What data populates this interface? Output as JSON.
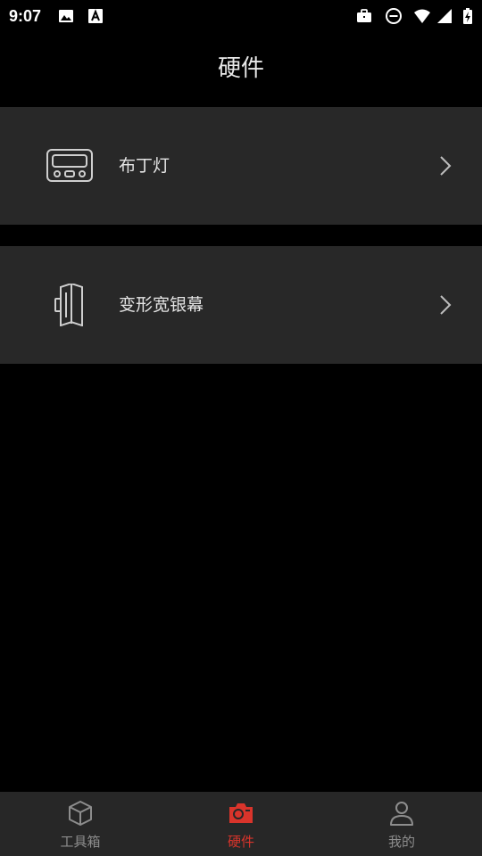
{
  "status_bar": {
    "time": "9:07",
    "icons": [
      "image-icon",
      "font-a-icon",
      "briefcase-icon",
      "do-not-disturb-icon",
      "wifi-icon",
      "cellular-signal-icon",
      "battery-charging-icon"
    ]
  },
  "header": {
    "title": "硬件"
  },
  "devices": [
    {
      "label": "布丁灯",
      "icon": "pudding-lamp-icon"
    },
    {
      "label": "变形宽银幕",
      "icon": "anamorphic-lens-icon"
    }
  ],
  "bottom_nav": {
    "tabs": [
      {
        "label": "工具箱",
        "icon": "cube-icon",
        "active": false
      },
      {
        "label": "硬件",
        "icon": "camera-icon",
        "active": true
      },
      {
        "label": "我的",
        "icon": "person-icon",
        "active": false
      }
    ]
  },
  "colors": {
    "background": "#000000",
    "card": "#282828",
    "nav_background": "#272727",
    "accent": "#d9342b",
    "inactive": "#8d8d8d"
  }
}
